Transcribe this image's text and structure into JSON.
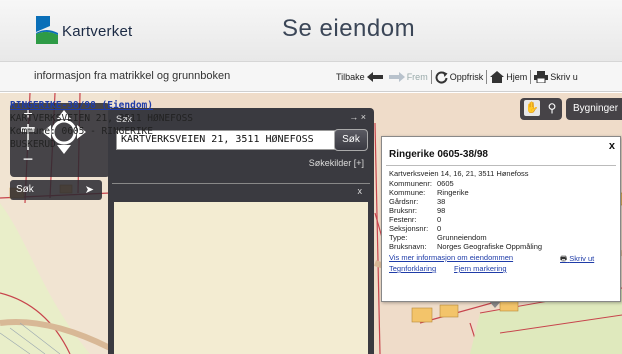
{
  "header": {
    "logo_text": "Kartverket",
    "page_title": "Se eiendom"
  },
  "subheader": {
    "subtitle": "informasjon fra matrikkel og grunnboken",
    "toolbar": {
      "back": "Tilbake",
      "forward": "Frem",
      "refresh": "Oppfrisk",
      "home": "Hjem",
      "print": "Skriv u"
    }
  },
  "map_controls": {
    "search_label": "Søk",
    "layers_label": "Bygninger"
  },
  "search_panel": {
    "header": "Søk",
    "header_icons": "→ ×",
    "input_value": "KARTVERKSVEIEN 21, 3511 HØNEFOSS",
    "go_label": "Søk",
    "sources_label": "Søkekilder [+]",
    "results_close": "x",
    "result": {
      "link": "RINGERIKE-38/98 (Eiendom)",
      "line1": "KARTVERKSVEIEN 21, 3511 HØNEFOSS",
      "line2": "Kommune: 0605 - RINGERIKE",
      "line3": "BUSKERUD"
    }
  },
  "popup": {
    "title": "Ringerike 0605-38/98",
    "close": "x",
    "address": "Kartverksveien 14, 16, 21, 3511 Hønefoss",
    "rows": [
      {
        "key": "Kommunenr:",
        "value": "0605"
      },
      {
        "key": "Kommune:",
        "value": "Ringerike"
      },
      {
        "key": "Gårdsnr:",
        "value": "38"
      },
      {
        "key": "Bruksnr:",
        "value": "98"
      },
      {
        "key": "Festenr:",
        "value": "0"
      },
      {
        "key": "Seksjonsnr:",
        "value": "0"
      },
      {
        "key": "Type:",
        "value": "Grunneiendom"
      },
      {
        "key": "Bruksnavn:",
        "value": "Norges Geografiske Oppmåling"
      }
    ],
    "link_more": "Vis mer informasjon om eiendommen",
    "link_print": "Skriv ut",
    "link_legend": "Tegnforklaring",
    "link_remove": "Fjern markering"
  },
  "colors": {
    "accent_blue": "#1f3ca8",
    "panel_dark": "#3a3a40",
    "result_bg": "#f3ecd2",
    "logo_blue": "#0a6fb8",
    "logo_green": "#2e9b46"
  },
  "icons": [
    "logo-icon",
    "back-arrow-icon",
    "forward-arrow-icon",
    "refresh-icon",
    "home-icon",
    "print-icon",
    "zoom-plus-icon",
    "zoom-minus-icon",
    "pan-icon",
    "hand-icon",
    "magnifier-icon"
  ]
}
